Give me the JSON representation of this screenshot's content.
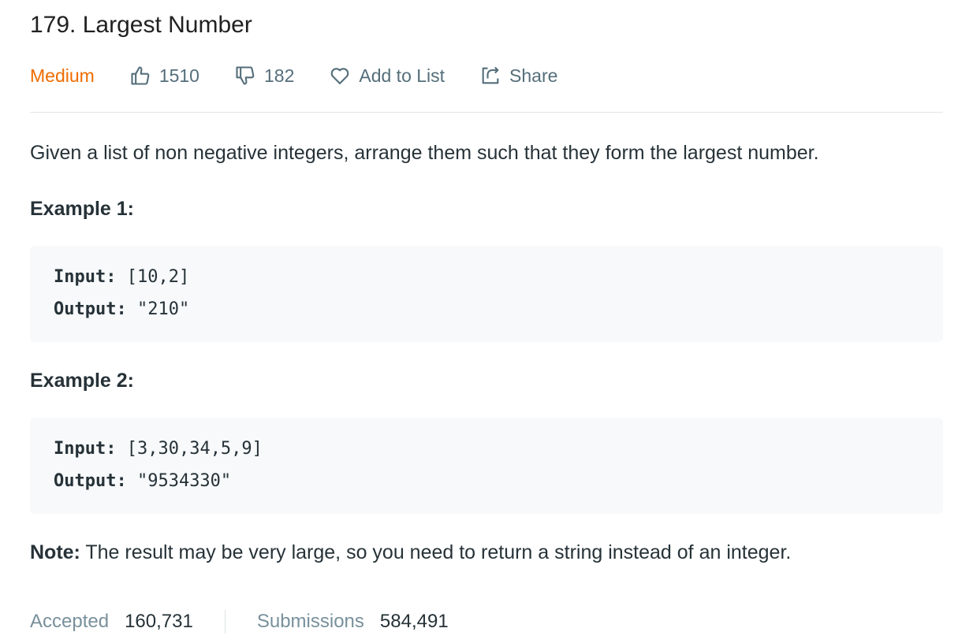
{
  "problem": {
    "title": "179. Largest Number",
    "difficulty": "Medium",
    "likes": "1510",
    "dislikes": "182",
    "add_to_list_label": "Add to List",
    "share_label": "Share"
  },
  "description": {
    "text": "Given a list of non negative integers, arrange them such that they form the largest number."
  },
  "examples": [
    {
      "heading": "Example 1:",
      "input_label": "Input:",
      "input_value": " [10,2]",
      "output_label": "Output:",
      "output_value": " \"210\""
    },
    {
      "heading": "Example 2:",
      "input_label": "Input:",
      "input_value": " [3,30,34,5,9]",
      "output_label": "Output:",
      "output_value": " \"9534330\""
    }
  ],
  "note": {
    "label": "Note:",
    "text": " The result may be very large, so you need to return a string instead of an integer."
  },
  "stats": {
    "accepted_label": "Accepted",
    "accepted_value": "160,731",
    "submissions_label": "Submissions",
    "submissions_value": "584,491"
  },
  "colors": {
    "difficulty_medium": "#ef6c00",
    "code_background": "#f7f9fa",
    "muted_text": "#546e7a"
  },
  "icons": [
    "thumbs-up-icon",
    "thumbs-down-icon",
    "heart-icon",
    "share-icon"
  ]
}
